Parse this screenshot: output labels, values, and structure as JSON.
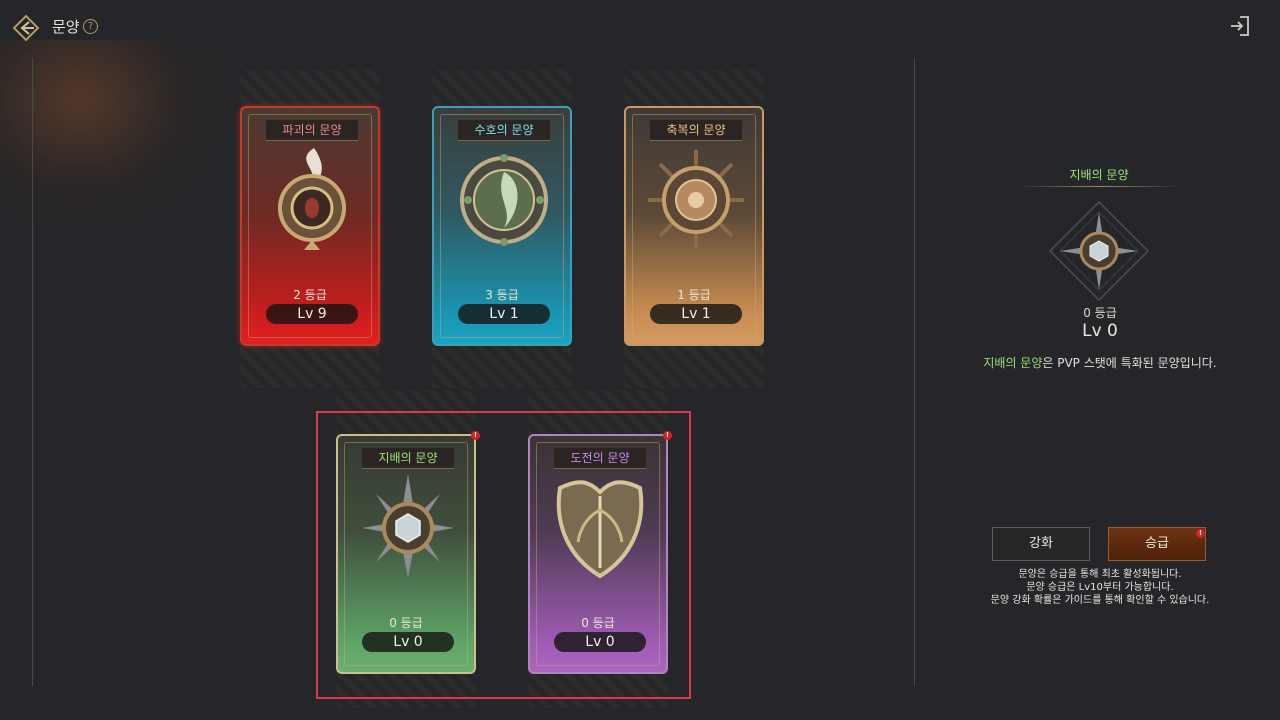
{
  "header": {
    "title": "문양",
    "help_symbol": "?"
  },
  "cards": [
    {
      "name": "파괴의 문양",
      "grade": "2 등급",
      "level": "Lv 9",
      "theme": "red",
      "accent": "#c51d1d"
    },
    {
      "name": "수호의 문양",
      "grade": "3 등급",
      "level": "Lv 1",
      "theme": "teal",
      "accent": "#1a92ad"
    },
    {
      "name": "축복의 문양",
      "grade": "1 등급",
      "level": "Lv 1",
      "theme": "amber",
      "accent": "#c58a50"
    },
    {
      "name": "지배의 문양",
      "grade": "0 등급",
      "level": "Lv 0",
      "theme": "green",
      "accent": "#5ca065",
      "alert": "!"
    },
    {
      "name": "도전의 문양",
      "grade": "0 등급",
      "level": "Lv 0",
      "theme": "purple",
      "accent": "#9b5ab0",
      "alert": "!"
    }
  ],
  "detail": {
    "name": "지배의 문양",
    "grade": "0 등급",
    "level": "Lv 0",
    "description_highlight": "지배의 문양",
    "description_rest": "은 PVP 스탯에 특화된 문양입니다."
  },
  "actions": {
    "enhance_label": "강화",
    "upgrade_label": "승급",
    "upgrade_alert": "!"
  },
  "info_lines": [
    "문양은 승급을 통해 최초 활성화됩니다.",
    "문양 승급은 Lv10부터 가능합니다.",
    "문양 강화 확률은 가이드를 통해 확인할 수 있습니다."
  ],
  "colors": {
    "highlight_border": "#e0354e",
    "alert": "#d82020",
    "selected_name": "#a5e07a"
  }
}
